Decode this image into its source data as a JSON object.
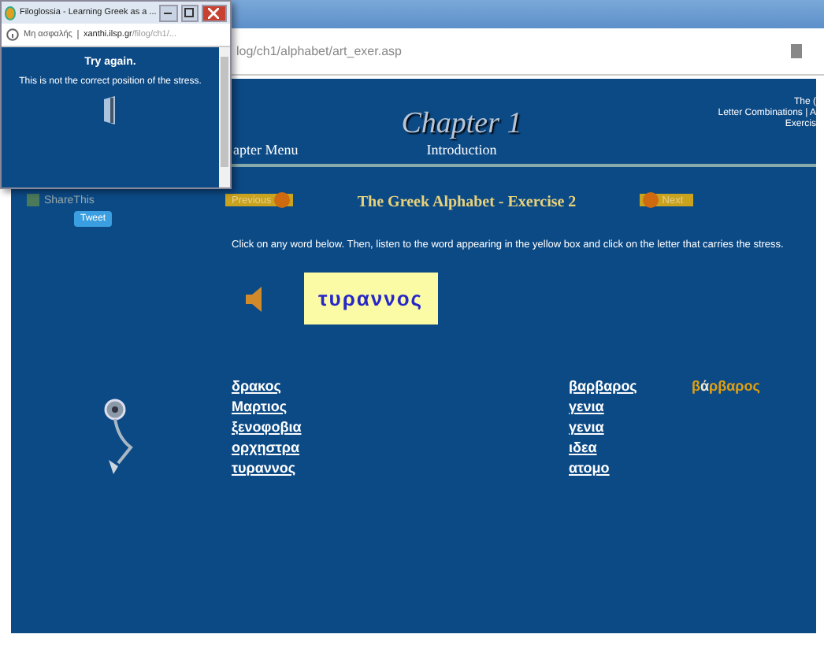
{
  "browser": {
    "address": "log/ch1/alphabet/art_exer.asp"
  },
  "header": {
    "menu_link": "apter Menu",
    "chapter_title": "Chapter 1",
    "chapter_subtitle": "Introduction",
    "right_links": [
      "The (",
      "Letter Combinations | A",
      "Exercis"
    ]
  },
  "share": {
    "label": "ShareThis",
    "tweet": "Tweet"
  },
  "nav": {
    "previous": "Previous",
    "title": "The Greek Alphabet - Exercise 2",
    "next": "Next"
  },
  "instruction": "Click on any word below. Then, listen to the word appearing in the yellow box and click on the letter that carries the stress.",
  "current_word": "τυραννος",
  "words_left": [
    "δρακος",
    "Μαρτιος",
    "ξενοφοβια",
    "ορχηστρα",
    "τυραννος"
  ],
  "words_right": [
    "βαρβαρος",
    "γενια",
    "γενια",
    "ιδεα",
    "ατομο"
  ],
  "answer": {
    "before": "β",
    "stressed": "ά",
    "after": "ρβαρος"
  },
  "popup": {
    "title": "Filoglossia - Learning Greek as a ...",
    "security": "Μη ασφαλής",
    "host": "xanthi.ilsp.gr",
    "path": "/filog/ch1/...",
    "heading": "Try again.",
    "message": "This is not the correct position of the stress."
  }
}
